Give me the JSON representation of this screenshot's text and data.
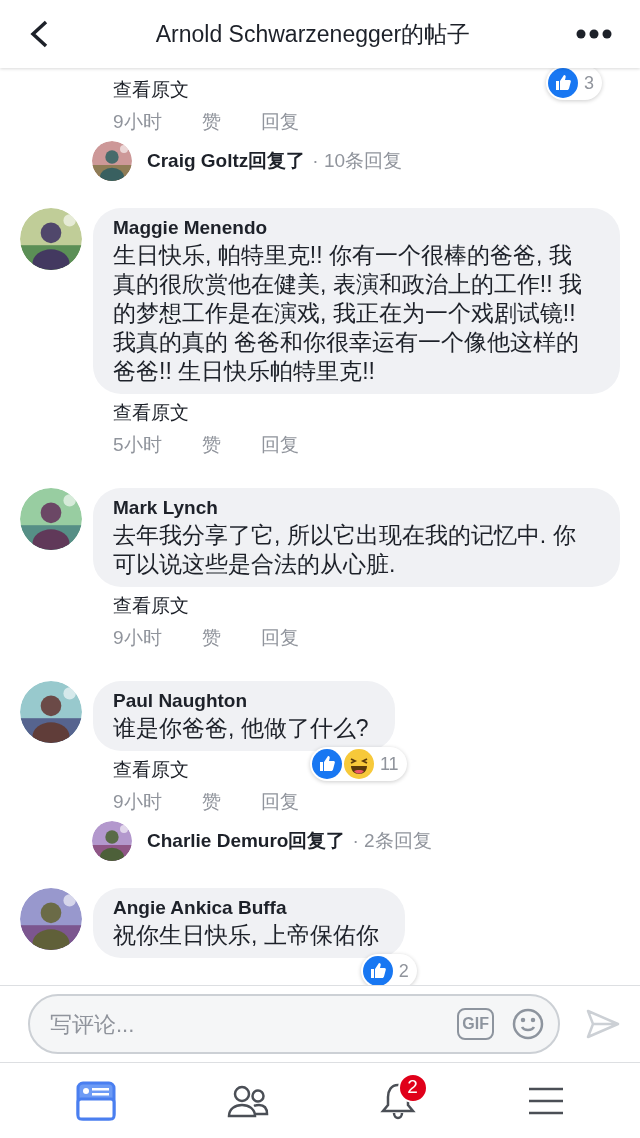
{
  "header": {
    "title": "Arnold Schwarzenegger的帖子"
  },
  "comments": [
    {
      "kind": "tail",
      "translate": "查看原文",
      "time": "9小时",
      "like": "赞",
      "reply": "回复",
      "reactions": [
        {
          "kind": "like"
        }
      ],
      "reaction_count": "3",
      "replies": {
        "text": "Craig Goltz回复了",
        "count": "· 10条回复"
      }
    },
    {
      "kind": "comment",
      "name": "Maggie Menendo",
      "body": "生日快乐, 帕特里克!! 你有一个很棒的爸爸, 我真的很欣赏他在健美, 表演和政治上的工作!! 我的梦想工作是在演戏, 我正在为一个戏剧试镜!! 我真的真的 爸爸和你很幸运有一个像他这样的爸爸!! 生日快乐帕特里克!!",
      "translate": "查看原文",
      "time": "5小时",
      "like": "赞",
      "reply": "回复"
    },
    {
      "kind": "comment",
      "name": "Mark Lynch",
      "body": "去年我分享了它, 所以它出现在我的记忆中. 你可以说这些是合法的从心脏.",
      "translate": "查看原文",
      "time": "9小时",
      "like": "赞",
      "reply": "回复"
    },
    {
      "kind": "comment",
      "name": "Paul Naughton",
      "body": "谁是你爸爸, 他做了什么?",
      "translate": "查看原文",
      "time": "9小时",
      "like": "赞",
      "reply": "回复",
      "reactions": [
        {
          "kind": "like"
        },
        {
          "kind": "haha"
        }
      ],
      "reaction_count": "11",
      "replies": {
        "text": "Charlie Demuro回复了",
        "count": "· 2条回复"
      }
    },
    {
      "kind": "comment",
      "name": "Angie Ankica Buffa",
      "body": "祝你生日快乐, 上帝保佑你",
      "reactions": [
        {
          "kind": "like"
        }
      ],
      "reaction_count": "2"
    }
  ],
  "composer": {
    "placeholder": "写评论...",
    "gif": "GIF"
  },
  "nav": [
    {
      "kind": "feed",
      "selected": true
    },
    {
      "kind": "friends",
      "selected": false
    },
    {
      "kind": "notifications",
      "selected": false,
      "badge": "2"
    },
    {
      "kind": "menu",
      "selected": false
    }
  ]
}
